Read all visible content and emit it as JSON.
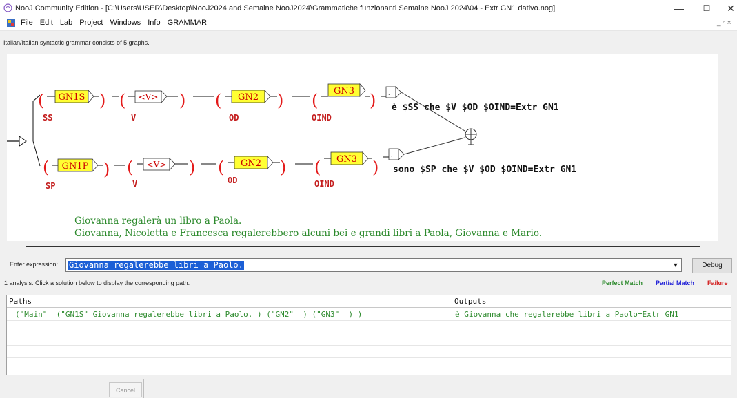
{
  "window": {
    "title": "NooJ Community Edition - [C:\\Users\\USER\\Desktop\\NooJ2024 and Semaine NooJ2024\\Grammatiche funzionanti Semaine NooJ 2024\\04 - Extr GN1 dativo.nog]",
    "controls": {
      "minimize": "—",
      "maximize": "☐",
      "close": "✕"
    }
  },
  "menu": {
    "items": [
      "File",
      "Edit",
      "Lab",
      "Project",
      "Windows",
      "Info",
      "GRAMMAR"
    ],
    "mdi": "_ ▫ ×"
  },
  "info_text": "Italian/Italian syntactic grammar consists of 5 graphs.",
  "graph": {
    "paren_open": "(",
    "paren_close": ")",
    "row1": {
      "boxes": [
        "GN1S",
        "<V>",
        "GN2",
        "GN3"
      ],
      "labels": [
        "SS",
        "V",
        "OD",
        "OIND"
      ],
      "output": "è $SS che $V $OD $OIND=Extr GN1"
    },
    "row2": {
      "boxes": [
        "GN1P",
        "<V>",
        "GN2",
        "GN3"
      ],
      "labels": [
        "SP",
        "V",
        "OD",
        "OIND"
      ],
      "output": "sono $SP che $V $OD $OIND=Extr GN1"
    },
    "comments": [
      "Giovanna regalerà un libro a Paola.",
      "Giovanna, Nicoletta e Francesca regalerebbero alcuni bei e grandi libri a Paola, Giovanna e Mario."
    ]
  },
  "expression": {
    "label": "Enter expression:",
    "value": "Giovanna regalerebbe libri a Paolo."
  },
  "debug_label": "Debug",
  "analysis_text": "1 analysis. Click a solution below to display the corresponding path:",
  "legend": [
    {
      "label": "Perfect Match",
      "color": "#2e8b2e"
    },
    {
      "label": "Partial Match",
      "color": "#1a1ad6"
    },
    {
      "label": "Failure",
      "color": "#d21f1f"
    }
  ],
  "results": {
    "headers": [
      "Paths",
      "Outputs"
    ],
    "rows": [
      {
        "path": "(\"Main\"  (\"GN1S\" Giovanna regalerebbe libri a Paolo. ) (\"GN2\"  ) (\"GN3\"  ) )",
        "output": "è Giovanna che regalerebbe libri a Paolo=Extr GN1"
      }
    ]
  },
  "cancel_label": "Cancel",
  "colors": {
    "node_fill": "#ffff33",
    "paren": "#e41a1a",
    "var_label": "#c41e1e",
    "comment": "#2d8a2d",
    "selection": "#1c5fd6"
  }
}
